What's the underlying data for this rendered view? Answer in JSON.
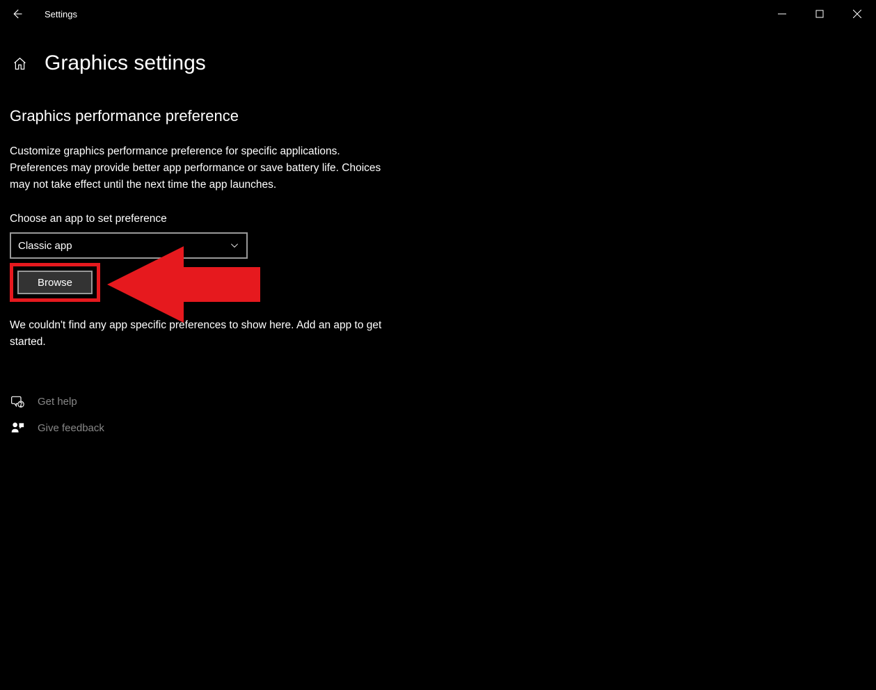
{
  "titlebar": {
    "app_title": "Settings"
  },
  "page": {
    "title": "Graphics settings"
  },
  "section": {
    "heading": "Graphics performance preference",
    "description": "Customize graphics performance preference for specific applications. Preferences may provide better app performance or save battery life. Choices may not take effect until the next time the app launches.",
    "choose_label": "Choose an app to set preference",
    "dropdown_value": "Classic app",
    "browse_label": "Browse",
    "empty_message": "We couldn't find any app specific preferences to show here. Add an app to get started."
  },
  "links": {
    "help": "Get help",
    "feedback": "Give feedback"
  },
  "colors": {
    "annotation_red": "#e6191e"
  }
}
